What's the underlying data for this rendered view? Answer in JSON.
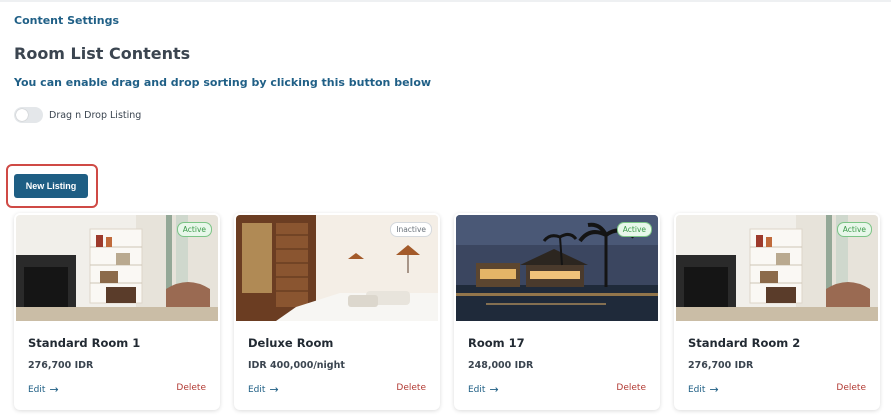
{
  "breadcrumb": "Content Settings",
  "page_title": "Room List Contents",
  "subtitle": "You can enable drag and drop sorting by clicking this button below",
  "toggle": {
    "label": "Drag n Drop Listing",
    "enabled": false
  },
  "new_listing_label": "New Listing",
  "colors": {
    "primary": "#1e5e84",
    "delete": "#b23b34",
    "highlight": "#cf4a45",
    "active_badge": "#3c9a4a"
  },
  "cards": [
    {
      "title": "Standard Room 1",
      "price": "276,700 IDR",
      "status": "Active",
      "edit_label": "Edit",
      "delete_label": "Delete",
      "image": "living-room"
    },
    {
      "title": "Deluxe Room",
      "price": "IDR 400,000/night",
      "status": "Inactive",
      "edit_label": "Edit",
      "delete_label": "Delete",
      "image": "bedroom"
    },
    {
      "title": "Room 17",
      "price": "248,000 IDR",
      "status": "Active",
      "edit_label": "Edit",
      "delete_label": "Delete",
      "image": "resort-pool-night"
    },
    {
      "title": "Standard Room 2",
      "price": "276,700 IDR",
      "status": "Active",
      "edit_label": "Edit",
      "delete_label": "Delete",
      "image": "living-room"
    }
  ]
}
